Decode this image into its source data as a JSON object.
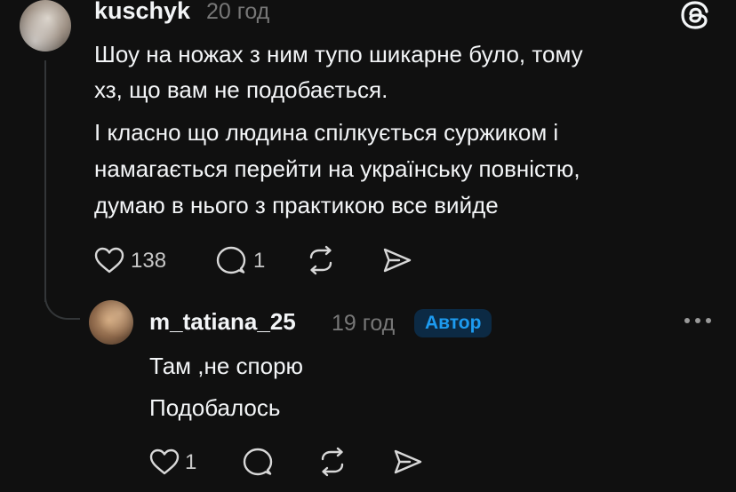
{
  "post": {
    "username": "kuschyk",
    "time": "20 год",
    "lines": [
      "Шоу на ножах з ним тупо шикарне було, тому",
      "хз, що вам не подобається.",
      "І класно що людина спілкується суржиком і",
      "намагається перейти на українську повністю,",
      "думаю в нього з практикою все вийде"
    ],
    "likes": "138",
    "replies": "1"
  },
  "reply": {
    "username": "m_tatiana_25",
    "time": "19 год",
    "badge": "Автор",
    "lines": [
      "Там ,не спорю",
      "Подобалось"
    ],
    "likes": "1"
  },
  "icons": {
    "app_logo": "threads-logo-icon",
    "more": "more-dots-icon",
    "like": "heart-icon",
    "reply": "comment-icon",
    "repost": "repost-icon",
    "share": "send-icon"
  },
  "colors": {
    "background": "#101010",
    "text": "#f3f5f7",
    "muted": "#777777",
    "badge_text": "#1d9bf0",
    "badge_bg": "#0c2a44"
  }
}
